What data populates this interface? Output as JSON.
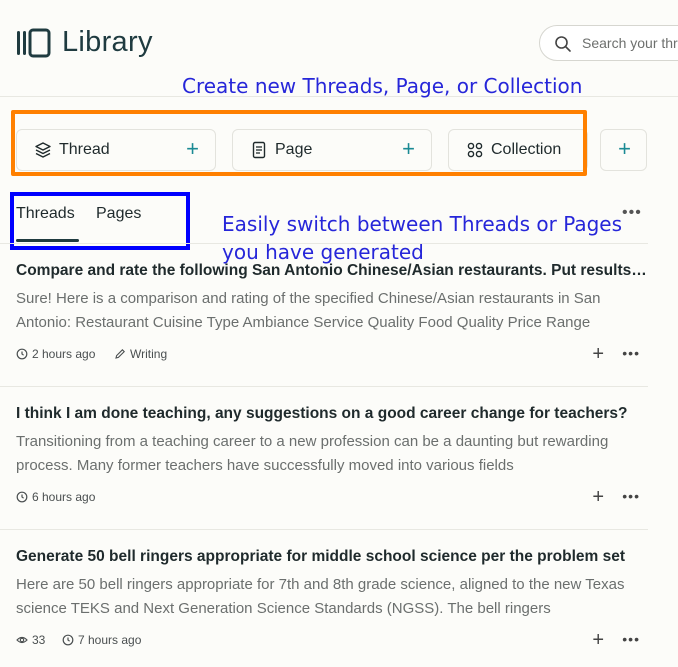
{
  "header": {
    "title": "Library",
    "search_placeholder": "Search your threads"
  },
  "annotations": {
    "create_note": "Create new Threads, Page, or Collection",
    "switch_note_line1": "Easily switch between Threads or Pages",
    "switch_note_line2": "you have generated"
  },
  "create_cards": [
    {
      "label": "Thread",
      "icon": "layers-icon"
    },
    {
      "label": "Page",
      "icon": "document-icon"
    },
    {
      "label": "Collection",
      "icon": "grid-dots-icon"
    }
  ],
  "tabs": [
    {
      "label": "Threads",
      "active": true
    },
    {
      "label": "Pages",
      "active": false
    }
  ],
  "threads": [
    {
      "title": "Compare and rate the following San Antonio Chinese/Asian restaurants. Put results in a table",
      "preview": "Sure! Here is a comparison and rating of the specified Chinese/Asian restaurants in San Antonio: Restaurant Cuisine Type Ambiance Service Quality Food Quality Price Range",
      "time": "2 hours ago",
      "tag": "Writing"
    },
    {
      "title": "I think I am done teaching, any suggestions on a good career change for teachers?",
      "preview": "Transitioning from a teaching career to a new profession can be a daunting but rewarding process. Many former teachers have successfully moved into various fields",
      "time": "6 hours ago"
    },
    {
      "title": "Generate 50 bell ringers appropriate for middle school science per the problem set",
      "preview": "Here are 50 bell ringers appropriate for 7th and 8th grade science, aligned to the new Texas science TEKS and Next Generation Science Standards (NGSS). The bell ringers",
      "views": "33",
      "time": "7 hours ago"
    }
  ],
  "colors": {
    "accent": "#1a8a94",
    "orange_annotation": "#ff8000",
    "blue_annotation": "#0000ff",
    "note_text": "#2626d9"
  }
}
